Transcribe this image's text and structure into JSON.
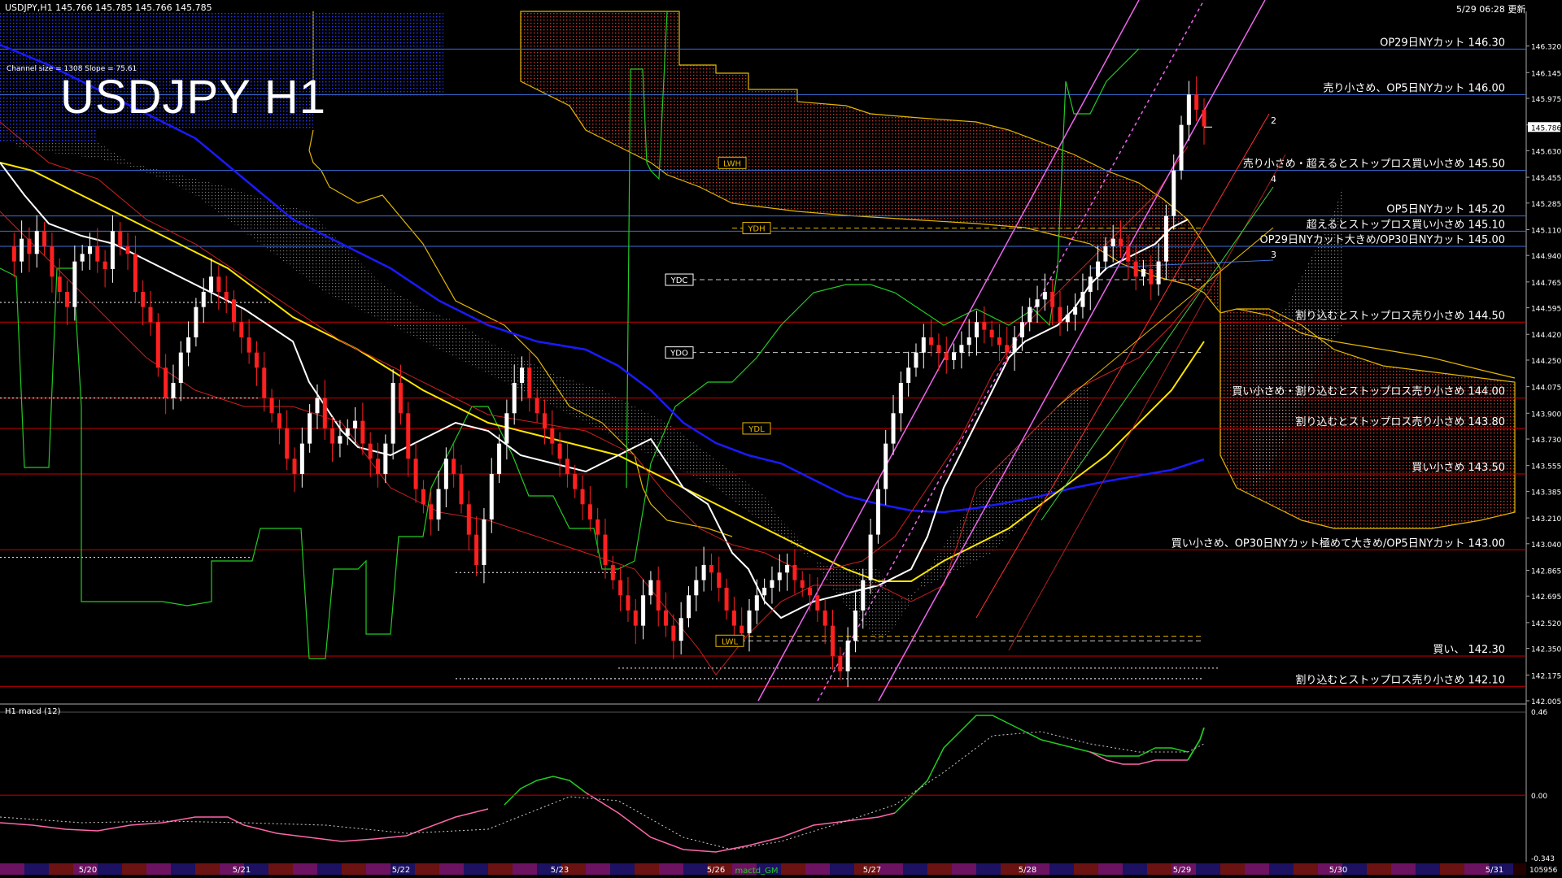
{
  "header": {
    "symbol_info": "USDJPY,H1  145.766 145.785 145.766 145.785",
    "timestamp": "5/29 06:28 更新",
    "channel": "Channel size = 1308 Slope = 75.61",
    "title": "USDJPY H1",
    "macd_label": "H1  macd (12)"
  },
  "colors": {
    "background": "#000000",
    "bull": "#ffffff",
    "bear": "#ff2020",
    "ma_white": "#ffffff",
    "ma_yellow": "#ffe600",
    "ma_blue": "#1a1aff",
    "chikou": "#22cc22",
    "kumo_red": "#c0392b",
    "kumo_white": "#bbbbbb",
    "level_line": "#cc0000",
    "channel": "#ee66ee",
    "grid_blue": "#3a6fd8"
  },
  "chart_data": {
    "type": "candlestick",
    "title": "USDJPY H1",
    "ylim": [
      142.005,
      146.425
    ],
    "price_ticks": [
      "146.320",
      "146.145",
      "145.975",
      "145.800",
      "145.630",
      "145.455",
      "145.285",
      "145.110",
      "144.940",
      "144.765",
      "144.595",
      "144.420",
      "144.250",
      "144.075",
      "143.900",
      "143.730",
      "143.555",
      "143.385",
      "143.210",
      "143.040",
      "142.865",
      "142.695",
      "142.520",
      "142.350",
      "142.175",
      "142.005"
    ],
    "current_price": "145.786",
    "dates": [
      "5/20",
      "5/21",
      "5/22",
      "5/23",
      "5/26",
      "5/27",
      "5/28",
      "5/29",
      "5/30",
      "5/31"
    ],
    "levels": [
      {
        "price": 146.3,
        "label": "OP29日NYカット 146.30",
        "color": "#3a6fd8"
      },
      {
        "price": 146.0,
        "label": "売り小さめ、OP5日NYカット 146.00",
        "color": "#3a6fd8"
      },
      {
        "price": 145.5,
        "label": "売り小さめ・超えるとストップロス買い小さめ 145.50",
        "color": "#3a6fd8"
      },
      {
        "price": 145.2,
        "label": "OP5日NYカット 145.20",
        "color": "#3a6fd8"
      },
      {
        "price": 145.1,
        "label": "超えるとストップロス買い小さめ 145.10",
        "color": "#3a6fd8"
      },
      {
        "price": 145.0,
        "label": "OP29日NYカット大きめ/OP30日NYカット 145.00",
        "color": "#3a6fd8"
      },
      {
        "price": 144.5,
        "label": "割り込むとストップロス売り小さめ 144.50",
        "color": "#cc0000"
      },
      {
        "price": 144.0,
        "label": "買い小さめ・割り込むとストップロス売り小さめ 144.00",
        "color": "#cc0000"
      },
      {
        "price": 143.8,
        "label": "割り込むとストップロス売り小さめ 143.80",
        "color": "#cc0000"
      },
      {
        "price": 143.5,
        "label": "買い小さめ 143.50",
        "color": "#cc0000"
      },
      {
        "price": 143.0,
        "label": "買い小さめ、OP30日NYカット極めて大きめ/OP5日NYカット 143.00",
        "color": "#cc0000"
      },
      {
        "price": 142.3,
        "label": "買い、  142.30",
        "color": "#cc0000"
      },
      {
        "price": 142.1,
        "label": "割り込むとストップロス売り小さめ 142.10",
        "color": "#cc0000"
      }
    ],
    "markers": [
      {
        "label": "LWH",
        "price": 145.55
      },
      {
        "label": "YDH",
        "price": 145.12
      },
      {
        "label": "YDC",
        "price": 144.78
      },
      {
        "label": "YDO",
        "price": 144.3
      },
      {
        "label": "YDL",
        "price": 143.8
      },
      {
        "label": "LWL",
        "price": 142.4
      }
    ],
    "channel_labels": [
      "2",
      "4",
      "3"
    ],
    "macd_ticks": [
      "0.46",
      "0.00",
      "-0.343"
    ],
    "volume_label": "105956",
    "nav_label": "mactd_GM"
  }
}
